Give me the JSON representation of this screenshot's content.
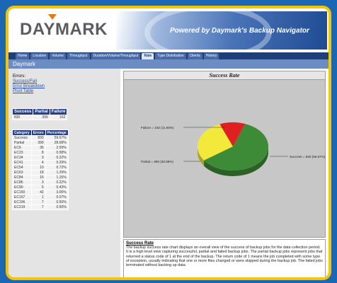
{
  "header": {
    "logo": "DAYMARK",
    "banner": "Powered by Daymark's Backup Navigator"
  },
  "nav": {
    "tabs": [
      "Home",
      "Location",
      "Volume",
      "Throughput",
      "Duration/Volume/Throughput",
      "Rate",
      "Type Distribution",
      "Clients",
      "History"
    ],
    "active_tab": "Rate"
  },
  "subheader": "Daymark",
  "sidebar": {
    "heading": "Errors:",
    "links": [
      "Success/Fail",
      "Error Breakdown",
      "Pivot Table"
    ],
    "summary": {
      "headers": [
        "Success",
        "Partial",
        "Failure"
      ],
      "values": [
        "830",
        "399",
        "162"
      ]
    },
    "categories": {
      "headers": [
        "Category",
        "Errors",
        "Percentage"
      ],
      "rows": [
        [
          "Success",
          "830",
          "59.67%"
        ],
        [
          "Partial",
          "399",
          "28.68%"
        ],
        [
          "EC6",
          "36",
          "2.59%"
        ],
        [
          "EC23",
          "8",
          "0.58%"
        ],
        [
          "EC34",
          "3",
          "0.22%"
        ],
        [
          "EC41",
          "4",
          "0.29%"
        ],
        [
          "EC54",
          "10",
          "0.72%"
        ],
        [
          "EC63",
          "18",
          "1.29%"
        ],
        [
          "EC84",
          "16",
          "1.15%"
        ],
        [
          "EC86",
          "3",
          "0.22%"
        ],
        [
          "EC90",
          "6",
          "0.43%"
        ],
        [
          "EC150",
          "42",
          "3.06%"
        ],
        [
          "EC157",
          "1",
          "0.07%"
        ],
        [
          "EC196",
          "7",
          "0.50%"
        ],
        [
          "EC219",
          "7",
          "0.50%"
        ]
      ]
    }
  },
  "chart_title": "Success Rate",
  "chart_data": {
    "type": "pie",
    "categories": [
      "Success",
      "Partial",
      "Failure"
    ],
    "values": [
      830,
      399,
      162
    ],
    "labels": [
      "Success = 830 (59.67%)",
      "Partial = 399 (28.68%)",
      "Failure = 162 (11.65%)"
    ],
    "colors": [
      "#3d8b37",
      "#f2e93a",
      "#e02020"
    ]
  },
  "description": {
    "title": "Success Rate",
    "body": "The backup success rate chart displays an overall view of the success of backup jobs for the data collection period. It is a high level view capturing successful, partial and failed backup jobs. The partial backup jobs represent jobs that returned a status code of 1 at the end of the backup. The return code of 1 means the job completed with some type of exception, usually indicating that one or more files changed or were skipped during the backup job. The failed jobs terminated without backing up data."
  }
}
